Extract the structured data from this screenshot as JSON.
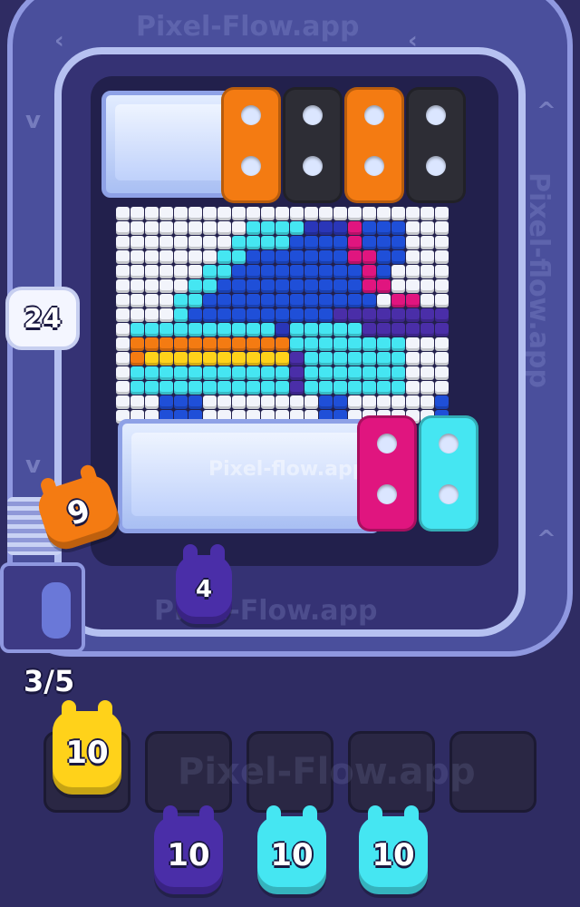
{
  "colors": {
    "background": "#2f2c63",
    "white": "#f2f4fb",
    "cyan": "#45e6f2",
    "blue": "#1f4fd8",
    "navy": "#2a36b8",
    "purple": "#4a2ea8",
    "magenta": "#e0157f",
    "orange": "#f47b12",
    "yellow": "#ffd21a",
    "black": "#2d2d35"
  },
  "watermarks": [
    "Pixel-Flow.app",
    "Pixel-flow.app",
    "Pixel-Flow.app",
    "Pixel-flow.app",
    "Pixel-Flow.app"
  ],
  "top_pegs": [
    {
      "color": "orange"
    },
    {
      "color": "black"
    },
    {
      "color": "orange"
    },
    {
      "color": "black"
    }
  ],
  "bottom_pegs": [
    {
      "color": "magenta"
    },
    {
      "color": "cyan"
    }
  ],
  "shooter": {
    "value": "24"
  },
  "conveyor_blobs": [
    {
      "value": "9",
      "color": "orange"
    },
    {
      "value": "4",
      "color": "purple"
    }
  ],
  "queue_counter": "3/5",
  "slot_blob": {
    "value": "10",
    "color": "yellow"
  },
  "waiting_blobs": [
    {
      "value": "10",
      "color": "purple"
    },
    {
      "value": "10",
      "color": "cyan"
    },
    {
      "value": "10",
      "color": "cyan"
    }
  ],
  "pixel_grid": [
    "W W W W W W W W W W W W W W W W W W W W W W W .",
    "W W W W W W W W W C C C C N N N M B B B W W W .",
    "W W W W W W W W C C C C B B B B M B B B W W W .",
    "W W W W W W W C C B B B B B B B M M B B W W W .",
    "W W W W W W C C B B B B B B B B B M B W W W W .",
    "W W W W W C C B B B B B B B B B B M M W W W W .",
    "W W W W C C B B B B B B B B B B B B W M M W W .",
    "W W W W C B B B B B B B B B B P P P P P P P P .",
    "W C C C C C C C C C C N C C C C C P P P P P P .",
    "W O O O O O O O O O O O C C C C C C C C W W W .",
    "W O Y Y Y Y Y Y Y Y Y Y P C C C C C C C W W W .",
    "W C C C C C C C C C C C P C C C C C C C W W W .",
    "W C C C C C C C C C C C P C C C C C C C W W W .",
    "W W W B B B W W W W W W W W B B W W W W W W B .",
    "W W W B B B W W W W W W W W B B W W W W W W B ."
  ]
}
